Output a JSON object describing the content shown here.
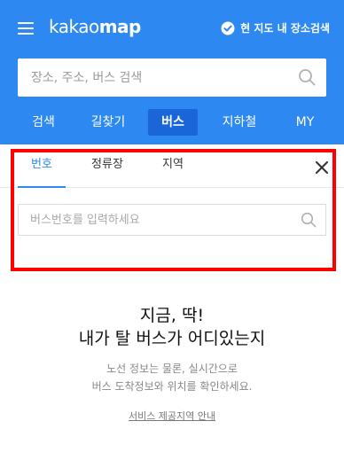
{
  "header": {
    "logo_light": "kakao",
    "logo_bold": "map",
    "location_search_label": "현 지도 내 장소검색"
  },
  "search": {
    "placeholder": "장소, 주소, 버스 검색"
  },
  "main_tabs": [
    {
      "label": "검색"
    },
    {
      "label": "길찾기"
    },
    {
      "label": "버스",
      "active": true
    },
    {
      "label": "지하철"
    },
    {
      "label": "MY"
    }
  ],
  "bus_panel": {
    "sub_tabs": [
      {
        "label": "번호",
        "active": true
      },
      {
        "label": "정류장"
      },
      {
        "label": "지역"
      }
    ],
    "search_placeholder": "버스번호를 입력하세요"
  },
  "intro": {
    "title_line1": "지금, 딱!",
    "title_line2": "내가 탈 버스가 어디있는지",
    "desc_line1": "노선 정보는 물론, 실시간으로",
    "desc_line2": "버스 도착정보와 위치를 확인하세요.",
    "link_label": "서비스 제공지역 안내"
  },
  "colors": {
    "brand_blue": "#2d88f2",
    "active_tab": "#1a66d8",
    "highlight": "#ff0000"
  },
  "icons": [
    "menu-icon",
    "check-circle-icon",
    "search-icon",
    "close-icon"
  ]
}
